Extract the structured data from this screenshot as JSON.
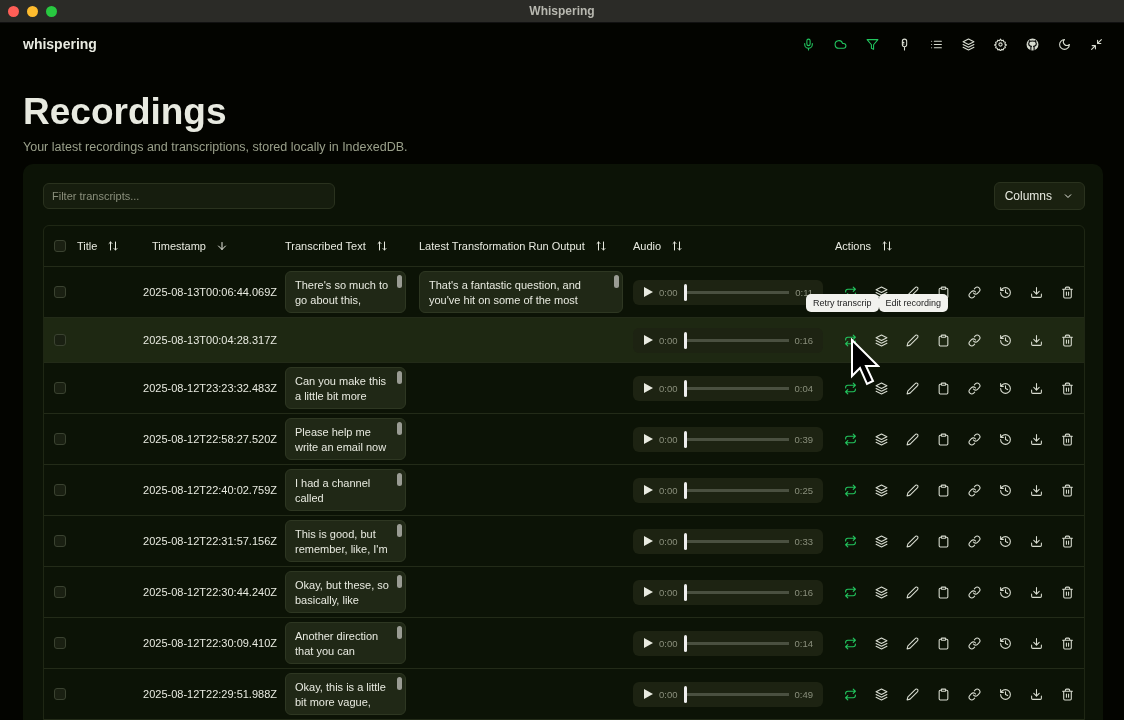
{
  "window": {
    "title": "Whispering"
  },
  "app_name": "whispering",
  "nav_buttons": [
    {
      "kind": "mic",
      "active": true
    },
    {
      "kind": "cloud",
      "active": true
    },
    {
      "kind": "filter",
      "active": true
    },
    {
      "kind": "studio-mic",
      "active": false
    },
    {
      "kind": "list",
      "active": false
    },
    {
      "kind": "layers",
      "active": false
    },
    {
      "kind": "gear",
      "active": false
    },
    {
      "kind": "cat",
      "active": false
    },
    {
      "kind": "moon",
      "active": false
    },
    {
      "kind": "minimize",
      "active": false
    }
  ],
  "page": {
    "title": "Recordings",
    "subtitle": "Your latest recordings and transcriptions, stored locally in IndexedDB."
  },
  "filter": {
    "placeholder": "Filter transcripts..."
  },
  "columns_button": "Columns",
  "table": {
    "select_all_checked": false,
    "columns": [
      {
        "label": "Title",
        "kind": "sortable"
      },
      {
        "label": "Timestamp",
        "kind": "sorted"
      },
      {
        "label": "Transcribed Text",
        "kind": "sortable"
      },
      {
        "label": "Latest Transformation Run Output",
        "kind": "sortable"
      },
      {
        "label": "Audio",
        "kind": "sortable"
      },
      {
        "label": "Actions",
        "kind": "sortable"
      }
    ],
    "rows": [
      {
        "checked": false,
        "timestamp": "2025-08-13T00:06:44.069Z",
        "transcribed_text": "There's so much to go about this,",
        "output": "That's a fantastic question, and you've hit on some of the most",
        "audio": {
          "current": "0:00",
          "duration": "0:11",
          "level": 0
        },
        "hovered": false
      },
      {
        "checked": false,
        "timestamp": "2025-08-13T00:04:28.317Z",
        "audio": {
          "current": "0:00",
          "duration": "0:16",
          "level": 0
        },
        "hovered": true
      },
      {
        "checked": false,
        "timestamp": "2025-08-12T23:23:32.483Z",
        "transcribed_text": "Can you make this a little bit more",
        "audio": {
          "current": "0:00",
          "duration": "0:04",
          "level": 0
        },
        "hovered": false
      },
      {
        "checked": false,
        "timestamp": "2025-08-12T22:58:27.520Z",
        "transcribed_text": "Please help me write an email now",
        "audio": {
          "current": "0:00",
          "duration": "0:39",
          "level": 0
        },
        "hovered": false
      },
      {
        "checked": false,
        "timestamp": "2025-08-12T22:40:02.759Z",
        "transcribed_text": "I had a channel called",
        "audio": {
          "current": "0:00",
          "duration": "0:25",
          "level": 0
        },
        "hovered": false
      },
      {
        "checked": false,
        "timestamp": "2025-08-12T22:31:57.156Z",
        "transcribed_text": "This is good, but remember, like, I'm",
        "audio": {
          "current": "0:00",
          "duration": "0:33",
          "level": 0
        },
        "hovered": false
      },
      {
        "checked": false,
        "timestamp": "2025-08-12T22:30:44.240Z",
        "transcribed_text": "Okay, but these, so basically, like",
        "audio": {
          "current": "0:00",
          "duration": "0:16",
          "level": 0
        },
        "hovered": false
      },
      {
        "checked": false,
        "timestamp": "2025-08-12T22:30:09.410Z",
        "transcribed_text": "Another direction that you can",
        "audio": {
          "current": "0:00",
          "duration": "0:14",
          "level": 0
        },
        "hovered": false
      },
      {
        "checked": false,
        "timestamp": "2025-08-12T22:29:51.988Z",
        "transcribed_text": "Okay, this is a little bit more vague,",
        "audio": {
          "current": "0:00",
          "duration": "0:49",
          "level": 0
        },
        "hovered": false
      }
    ]
  },
  "actions": [
    {
      "kind": "retry",
      "active": true
    },
    {
      "kind": "layers",
      "active": false
    },
    {
      "kind": "pencil",
      "active": false
    },
    {
      "kind": "clipboard",
      "active": false
    },
    {
      "kind": "link",
      "active": false
    },
    {
      "kind": "history",
      "active": false
    },
    {
      "kind": "download",
      "active": false
    },
    {
      "kind": "trash",
      "active": false
    }
  ],
  "tooltips": [
    "Retry transcrip",
    "Edit recording"
  ]
}
